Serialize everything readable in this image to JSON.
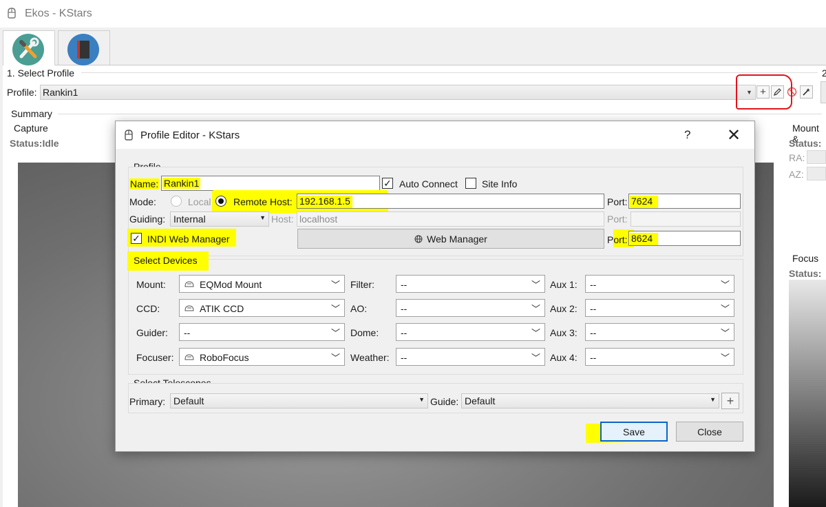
{
  "window": {
    "title": "Ekos - KStars"
  },
  "main": {
    "select_profile_label": "1. Select Profile",
    "profile_label": "Profile:",
    "profile_value": "Rankin1",
    "section2_label_fragment": "2",
    "summary_label": "Summary",
    "capture_label": "Capture",
    "capture_status": "Status:Idle",
    "mount_label": "Mount &",
    "mount_status": "Status:",
    "ra_label": "RA:",
    "az_label": "AZ:",
    "focus_label": "Focus",
    "focus_status": "Status:"
  },
  "dialog": {
    "title": "Profile Editor - KStars",
    "help": "?",
    "close": "✕",
    "profile_group": "Profile",
    "name_label": "Name:",
    "name_value": "Rankin1",
    "auto_connect": "Auto Connect",
    "auto_connect_checked": true,
    "site_info": "Site Info",
    "site_info_checked": false,
    "mode_label": "Mode:",
    "local_label": "Local",
    "remote_label": "Remote",
    "host_label": "Host:",
    "host_value": "192.168.1.5",
    "port_label": "Port:",
    "port_value": "7624",
    "guiding_label": "Guiding:",
    "guiding_value": "Internal",
    "guiding_host_label": "Host:",
    "guiding_host_value": "localhost",
    "guiding_port_label": "Port:",
    "indi_web_manager": "INDI Web Manager",
    "indi_web_manager_checked": true,
    "web_manager_button": "Web Manager",
    "web_port_label": "Port:",
    "web_port_value": "8624",
    "select_devices": "Select Devices",
    "devices": {
      "mount_label": "Mount:",
      "mount_value": "EQMod Mount",
      "ccd_label": "CCD:",
      "ccd_value": "ATIK CCD",
      "guider_label": "Guider:",
      "guider_value": "--",
      "focuser_label": "Focuser:",
      "focuser_value": "RoboFocus",
      "filter_label": "Filter:",
      "filter_value": "--",
      "ao_label": "AO:",
      "ao_value": "--",
      "dome_label": "Dome:",
      "dome_value": "--",
      "weather_label": "Weather:",
      "weather_value": "--",
      "aux1_label": "Aux 1:",
      "aux1_value": "--",
      "aux2_label": "Aux 2:",
      "aux2_value": "--",
      "aux3_label": "Aux 3:",
      "aux3_value": "--",
      "aux4_label": "Aux 4:",
      "aux4_value": "--"
    },
    "select_telescopes": "Select Telescopes",
    "primary_label": "Primary:",
    "primary_value": "Default",
    "guide_label": "Guide:",
    "guide_value": "Default",
    "add_telescope": "+",
    "save": "Save",
    "close_button": "Close"
  },
  "colors": {
    "highlight": "#ffff00",
    "annotation_red": "#e0141c",
    "setup_tab": "#4a9e93",
    "logbook_tab": "#3a7fc0"
  }
}
